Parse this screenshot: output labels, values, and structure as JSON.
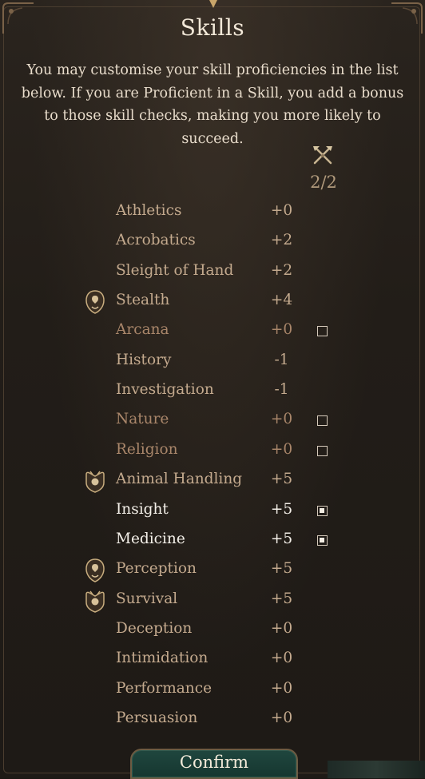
{
  "title": "Skills",
  "description": "You may customise your skill proficiencies in the list below. If you are Proficient in a Skill, you add a bonus to those skill checks, making you more likely to succeed.",
  "counter": "2/2",
  "confirm_label": "Confirm",
  "skills": [
    {
      "name": "Athletics",
      "bonus": "+0",
      "state": "dim"
    },
    {
      "name": "Acrobatics",
      "bonus": "+2",
      "state": "dim"
    },
    {
      "name": "Sleight of Hand",
      "bonus": "+2",
      "state": "dim"
    },
    {
      "name": "Stealth",
      "bonus": "+4",
      "state": "dim",
      "icon": "race-proficiency-icon"
    },
    {
      "name": "Arcana",
      "bonus": "+0",
      "state": "option",
      "checkbox": "unchecked"
    },
    {
      "name": "History",
      "bonus": "-1",
      "state": "dim"
    },
    {
      "name": "Investigation",
      "bonus": "-1",
      "state": "dim"
    },
    {
      "name": "Nature",
      "bonus": "+0",
      "state": "option",
      "checkbox": "unchecked"
    },
    {
      "name": "Religion",
      "bonus": "+0",
      "state": "option",
      "checkbox": "unchecked"
    },
    {
      "name": "Animal Handling",
      "bonus": "+5",
      "state": "dim",
      "icon": "background-proficiency-icon"
    },
    {
      "name": "Insight",
      "bonus": "+5",
      "state": "active",
      "checkbox": "checked"
    },
    {
      "name": "Medicine",
      "bonus": "+5",
      "state": "active",
      "checkbox": "checked"
    },
    {
      "name": "Perception",
      "bonus": "+5",
      "state": "dim",
      "icon": "race-proficiency-icon"
    },
    {
      "name": "Survival",
      "bonus": "+5",
      "state": "dim",
      "icon": "background-proficiency-icon"
    },
    {
      "name": "Deception",
      "bonus": "+0",
      "state": "dim"
    },
    {
      "name": "Intimidation",
      "bonus": "+0",
      "state": "dim"
    },
    {
      "name": "Performance",
      "bonus": "+0",
      "state": "dim"
    },
    {
      "name": "Persuasion",
      "bonus": "+0",
      "state": "dim"
    }
  ],
  "colors": {
    "background": "#221d18",
    "text_primary": "#f2e8d8",
    "text_dim": "#c4aa8e",
    "text_option": "#a9866a",
    "gold": "#c9a56a",
    "confirm_bg": "#1f463e"
  }
}
